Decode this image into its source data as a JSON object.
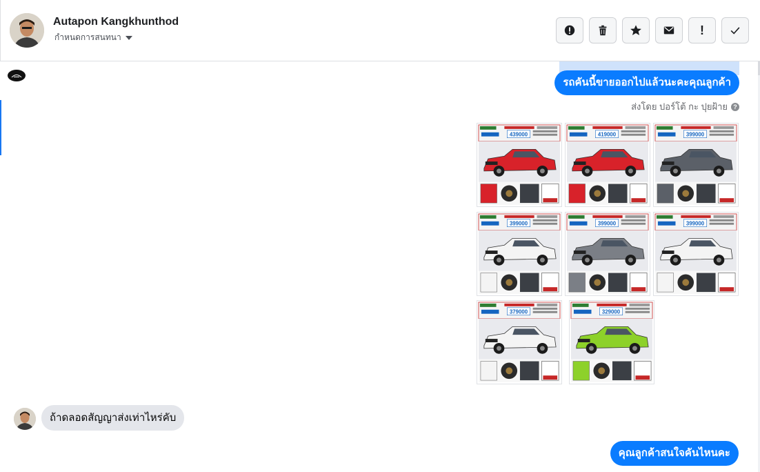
{
  "conversation": {
    "contact_name": "Autapon Kangkhunthod",
    "assign_label": "กำหนดการสนทนา"
  },
  "toolbar": {
    "buttons": [
      {
        "icon": "alert-circle-icon",
        "label": "!"
      },
      {
        "icon": "trash-icon"
      },
      {
        "icon": "star-icon"
      },
      {
        "icon": "envelope-icon"
      },
      {
        "icon": "exclamation-icon",
        "label": "!"
      },
      {
        "icon": "check-icon"
      }
    ]
  },
  "messages": {
    "out_1": "รถคันนี้ขายออกไปแล้วนะคะคุณลูกค้า",
    "sent_by": "ส่งโดย ปอร์โต้ กะ ปุยฝ้าย",
    "sent_by_help": "?",
    "in_1": "ถ้าดลอดสัญญาส่งเท่าไหร่คับ",
    "out_2": "คุณลูกค้าสนใจคันไหนคะ"
  },
  "photos": [
    {
      "price": "439000",
      "car_color": "#d8222a"
    },
    {
      "price": "419000",
      "car_color": "#d8222a"
    },
    {
      "price": "399000",
      "car_color": "#5b6068"
    },
    {
      "price": "399000",
      "car_color": "#f4f4f4"
    },
    {
      "price": "399000",
      "car_color": "#7b7f86"
    },
    {
      "price": "399000",
      "car_color": "#f4f4f4"
    },
    {
      "price": "379000",
      "car_color": "#f4f4f4"
    },
    {
      "price": "329000",
      "car_color": "#8dd12a"
    }
  ],
  "colors": {
    "accent": "#0a7cff",
    "incoming_bubble": "#e4e6eb"
  }
}
